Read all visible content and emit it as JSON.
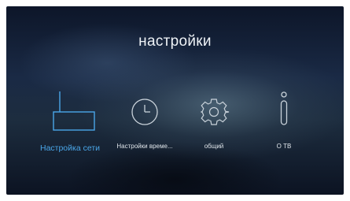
{
  "screen": {
    "title": "настройки"
  },
  "menu": {
    "items": [
      {
        "label": "Настройка сети",
        "icon": "network-icon",
        "selected": true
      },
      {
        "label": "Настройки време...",
        "icon": "clock-icon",
        "selected": false
      },
      {
        "label": "общий",
        "icon": "gear-icon",
        "selected": false
      },
      {
        "label": "О ТВ",
        "icon": "info-icon",
        "selected": false
      }
    ]
  },
  "colors": {
    "accent": "#4aa6e8",
    "text": "#dfe5ea",
    "icon": "#c9d2da"
  }
}
